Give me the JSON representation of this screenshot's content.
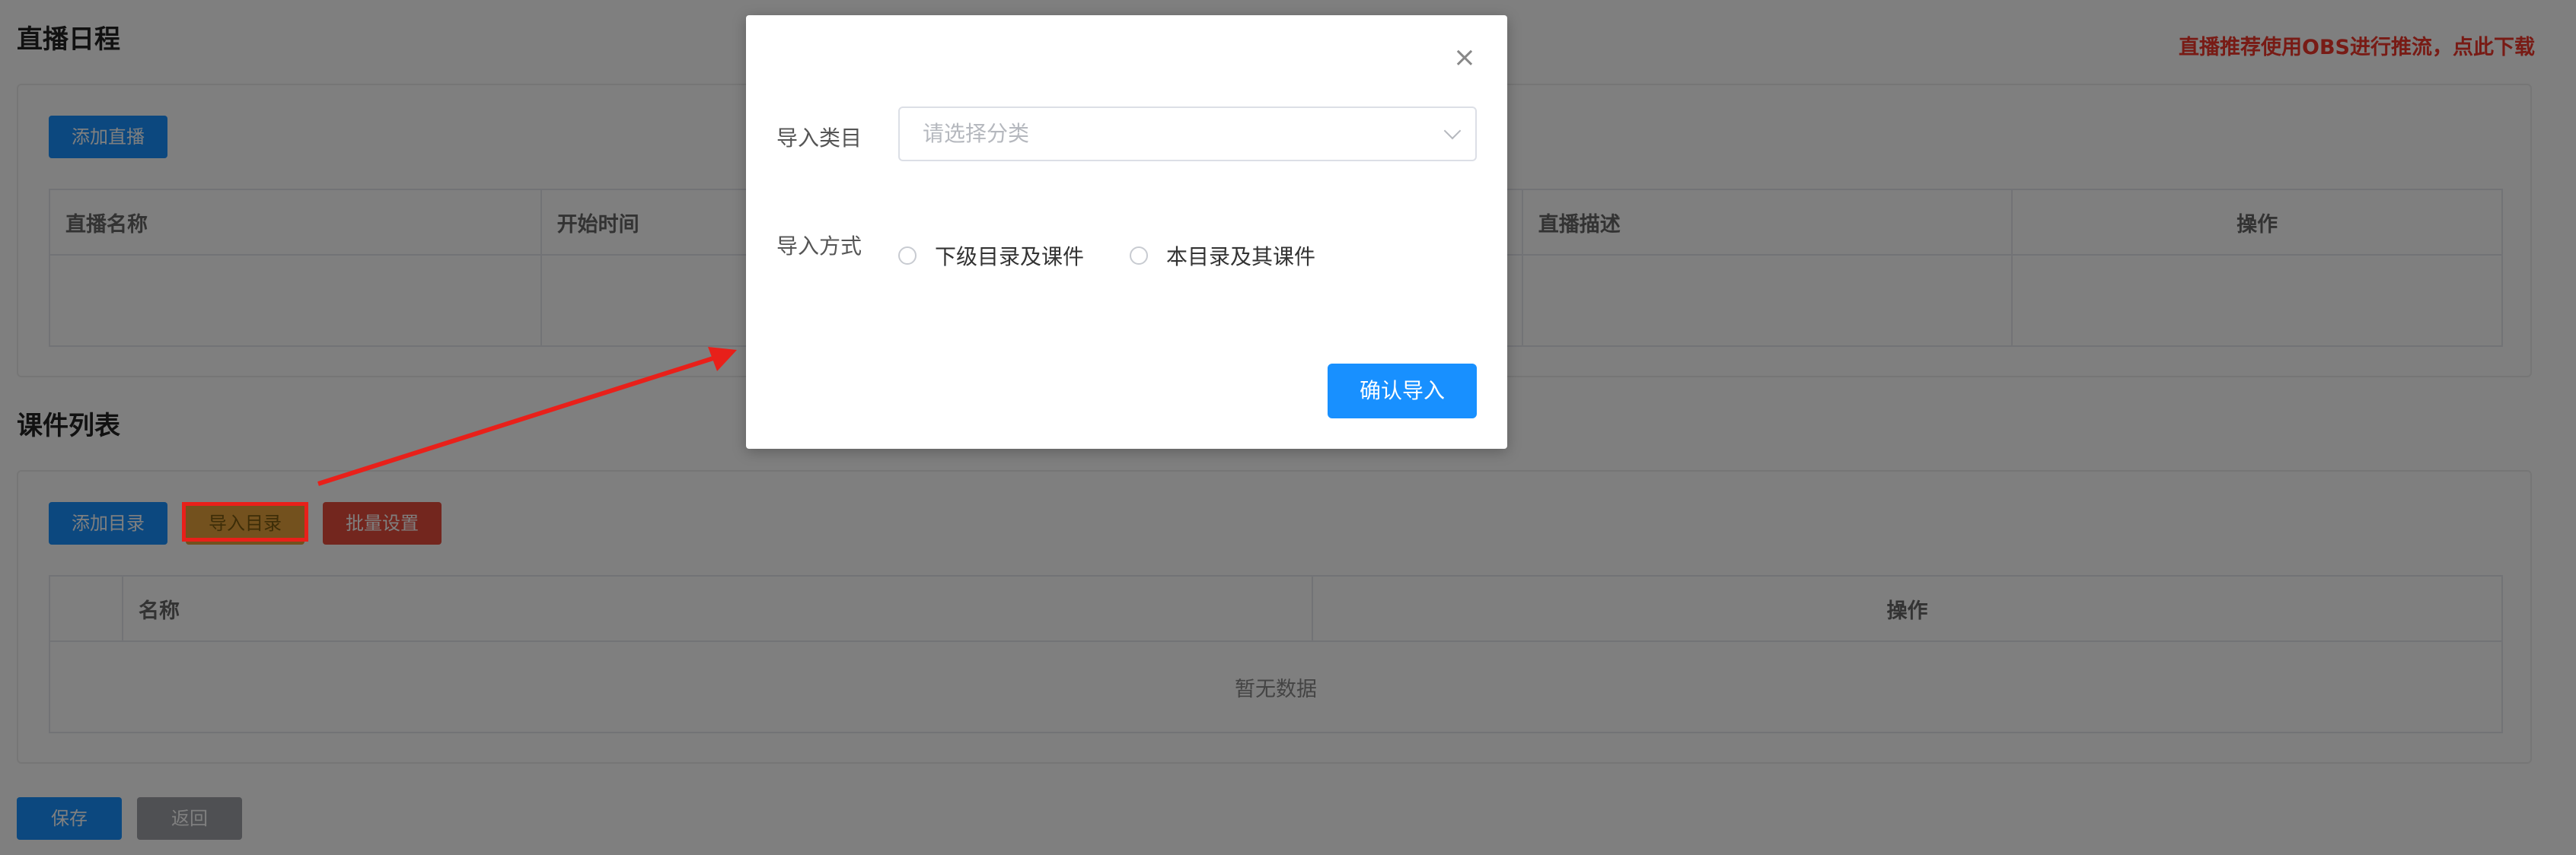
{
  "header": {
    "live_title": "直播日程",
    "obs_link": "直播推荐使用OBS进行推流，点此下载"
  },
  "live_section": {
    "add_button": "添加直播",
    "columns": [
      "直播名称",
      "开始时间",
      "",
      "直播描述",
      "操作"
    ]
  },
  "courseware_section": {
    "title": "课件列表",
    "add_dir_button": "添加目录",
    "import_dir_button": "导入目录",
    "batch_button": "批量设置",
    "columns": [
      "",
      "名称",
      "操作"
    ],
    "empty_text": "暂无数据"
  },
  "footer": {
    "save_button": "保存",
    "back_button": "返回"
  },
  "dialog": {
    "category_label": "导入类目",
    "category_placeholder": "请选择分类",
    "method_label": "导入方式",
    "option_1": "下级目录及课件",
    "option_2": "本目录及其课件",
    "confirm_button": "确认导入"
  },
  "colors": {
    "primary": "#1890ff",
    "danger": "#e74c3c",
    "warning": "#e6a23c",
    "annotation_red": "#e8201a"
  }
}
